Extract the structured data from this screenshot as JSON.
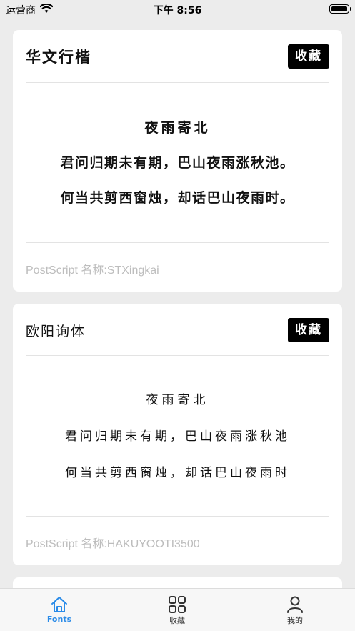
{
  "status_bar": {
    "carrier": "运营商",
    "time": "下午 8:56"
  },
  "cards": [
    {
      "font_name": "华文行楷",
      "favorite_label": "收藏",
      "poem_title": "夜雨寄北",
      "poem_lines": [
        "君问归期未有期，巴山夜雨涨秋池。",
        "何当共剪西窗烛，却话巴山夜雨时。"
      ],
      "postscript": "PostScript 名称:STXingkai"
    },
    {
      "font_name": "欧阳询体",
      "favorite_label": "收藏",
      "poem_title": "夜雨寄北",
      "poem_lines": [
        "君问归期未有期，巴山夜雨涨秋池",
        "何当共剪西窗烛，却话巴山夜雨时"
      ],
      "postscript": "PostScript 名称:HAKUYOOTI3500"
    }
  ],
  "tab_bar": {
    "tabs": [
      {
        "label": "Fonts",
        "icon": "home-icon",
        "active": true
      },
      {
        "label": "收藏",
        "icon": "grid-icon",
        "active": false
      },
      {
        "label": "我的",
        "icon": "person-icon",
        "active": false
      }
    ],
    "accent_color": "#2a8be8"
  }
}
